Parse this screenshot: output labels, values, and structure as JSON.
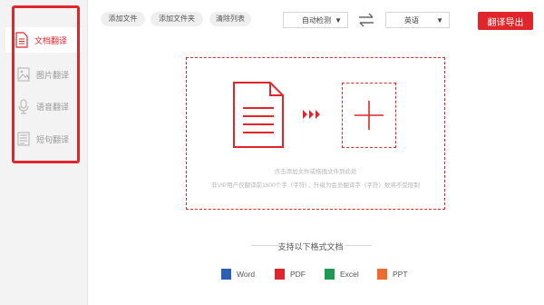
{
  "sidebar": {
    "items": [
      {
        "label": "文档翻译",
        "icon": "document-icon",
        "active": true
      },
      {
        "label": "图片翻译",
        "icon": "image-icon",
        "active": false
      },
      {
        "label": "语音翻译",
        "icon": "microphone-icon",
        "active": false
      },
      {
        "label": "短句翻译",
        "icon": "note-icon",
        "active": false
      }
    ]
  },
  "toolbar": {
    "add_file": "添加文件",
    "add_folder": "添加文件夹",
    "clear_list": "清除列表",
    "source_lang": "自动检测",
    "target_lang": "英语",
    "export": "翻译导出"
  },
  "dropzone": {
    "hint_primary": "点击添加文件或拖拽文件到此处",
    "hint_secondary": "非VIP用户仅翻译前1500个字（字符），升级为会员翻译字（字符）数将不受限制"
  },
  "formats": {
    "title": "支持以下格式文档",
    "items": [
      {
        "label": "Word",
        "color": "#2b5fb6"
      },
      {
        "label": "PDF",
        "color": "#e0262a"
      },
      {
        "label": "Excel",
        "color": "#1f9a53"
      },
      {
        "label": "PPT",
        "color": "#ee6a2f"
      }
    ]
  },
  "colors": {
    "accent": "#e0262a"
  }
}
